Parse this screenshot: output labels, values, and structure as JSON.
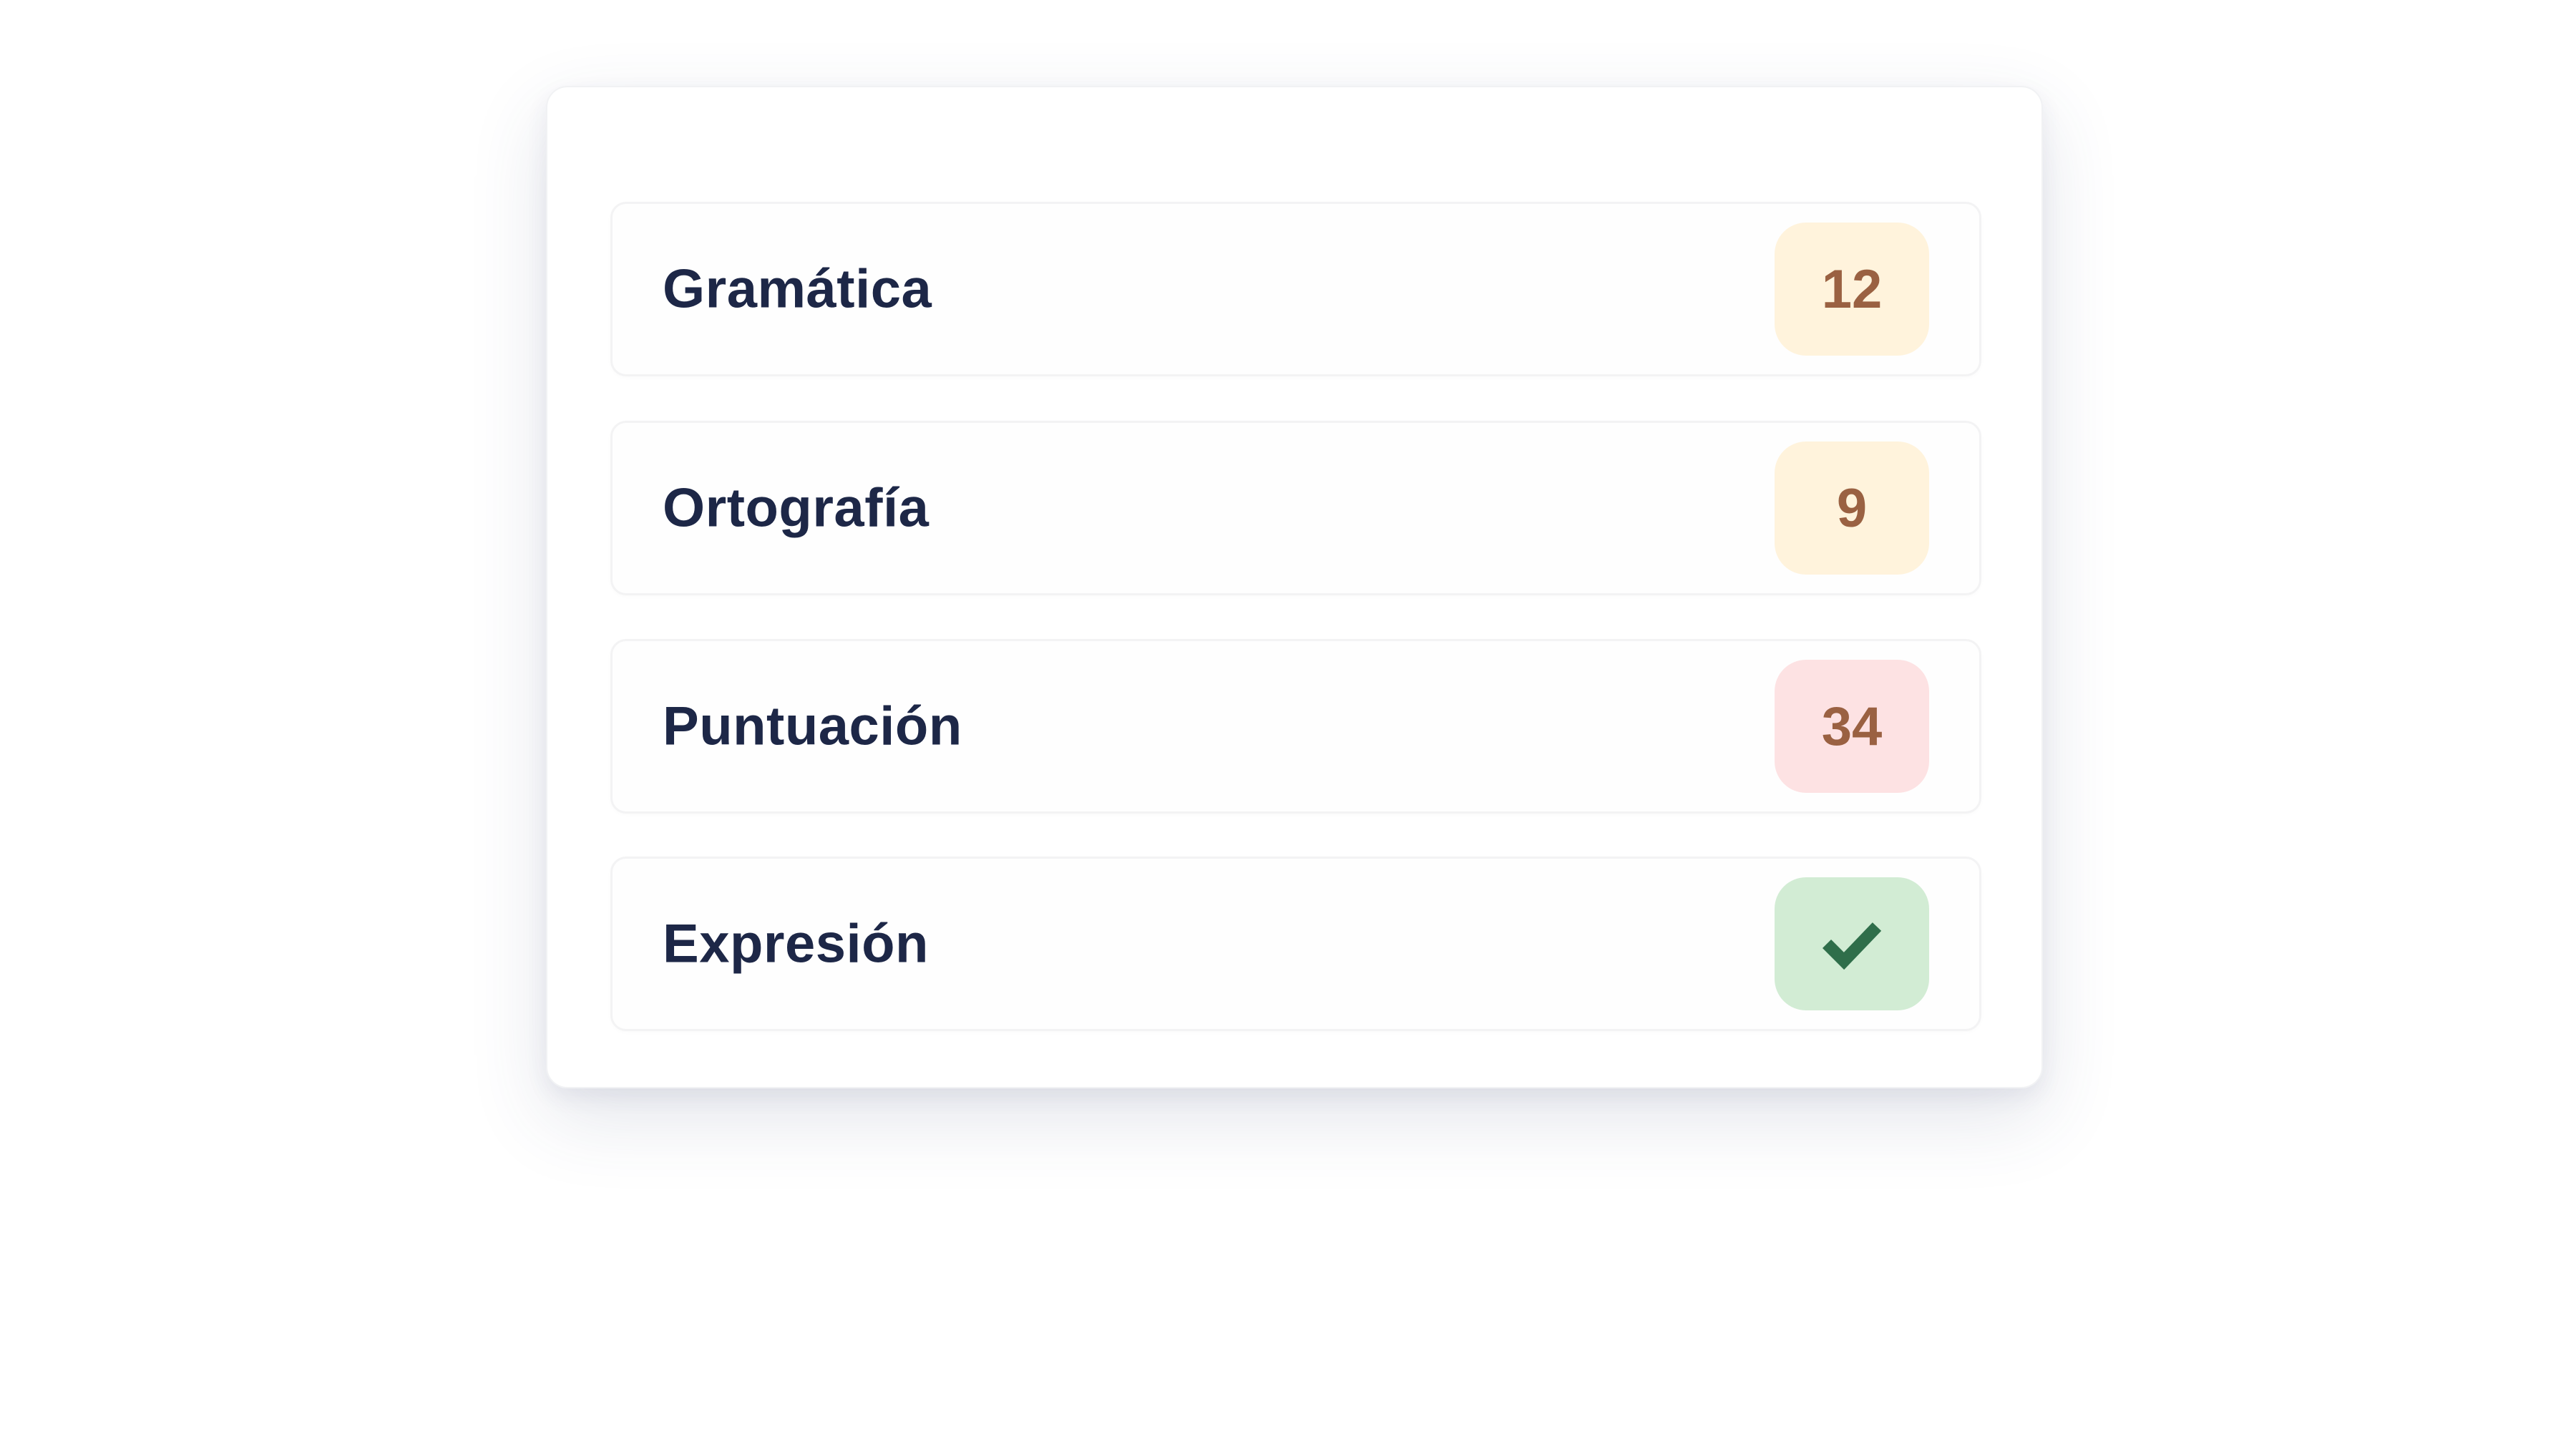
{
  "categories": [
    {
      "label": "Gramática",
      "count": "12",
      "status": "warning",
      "badge_color": "#fff3dc"
    },
    {
      "label": "Ortografía",
      "count": "9",
      "status": "warning",
      "badge_color": "#fff3dc"
    },
    {
      "label": "Puntuación",
      "count": "34",
      "status": "error",
      "badge_color": "#fde2e3"
    },
    {
      "label": "Expresión",
      "count": "",
      "status": "ok",
      "icon": "check-icon",
      "badge_color": "#d2ecd4"
    }
  ],
  "colors": {
    "label_text": "#1d2747",
    "count_text": "#9a6142",
    "check": "#2f6e4a"
  }
}
